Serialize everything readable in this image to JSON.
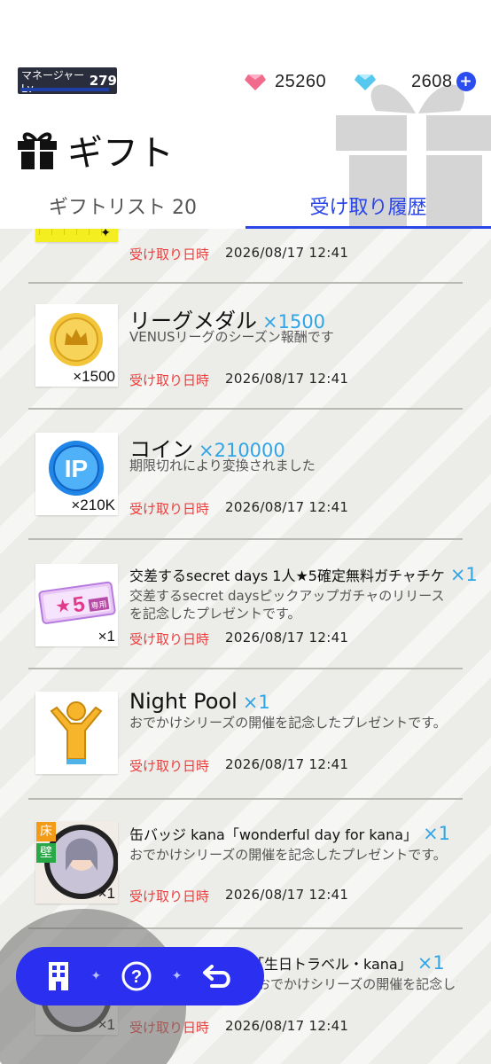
{
  "header": {
    "level_label": "マネージャーLv",
    "level_value": "279",
    "gem_paid": "25260",
    "gem_free": "2608",
    "title": "ギフト",
    "gift_icon": "gift-icon",
    "gem_icon": "diamond-icon"
  },
  "tabs": [
    {
      "label": "ギフトリスト 20",
      "active": false
    },
    {
      "label": "受け取り履歴",
      "active": true
    }
  ],
  "colors": {
    "accent": "#2b46e8",
    "received_label": "#ee3d3d",
    "multiplier": "#2fa5e8",
    "nav_bg": "#2b2fef"
  },
  "items": [
    {
      "title": "",
      "mult": "",
      "desc": "",
      "qty": "",
      "recv_label": "受け取り日時",
      "date": "2026/08/17  12:41"
    },
    {
      "title": "リーグメダル",
      "mult": "×1500",
      "desc": "VENUSリーグのシーズン報酬です",
      "qty": "×1500",
      "recv_label": "受け取り日時",
      "date": "2026/08/17  12:41"
    },
    {
      "title": "コイン",
      "mult": "×210000",
      "desc": "期限切れにより変換されました",
      "qty": "×210K",
      "recv_label": "受け取り日時",
      "date": "2026/08/17  12:41"
    },
    {
      "title": "交差するsecret days 1人★5確定無料ガチャチケ",
      "mult": "×1",
      "desc": "交差するsecret daysピックアップガチャのリリースを記念したプレゼントです。",
      "qty": "×1",
      "recv_label": "受け取り日時",
      "date": "2026/08/17  12:41",
      "ticket_text": "5",
      "ticket_sub": "専用"
    },
    {
      "title": "Night Pool",
      "mult": "×1",
      "desc": "おでかけシリーズの開催を記念したプレゼントです。",
      "qty": "",
      "recv_label": "受け取り日時",
      "date": "2026/08/17  12:41"
    },
    {
      "title": "缶バッジ kana「wonderful day for kana」",
      "mult": "×1",
      "desc": "おでかけシリーズの開催を記念したプレゼントです。",
      "qty": "×1",
      "recv_label": "受け取り日時",
      "date": "2026/08/17  12:41",
      "tag1": "床",
      "tag2": "壁"
    },
    {
      "title": "「生日トラベル・kana」",
      "mult": "×1",
      "desc": "おでかけシリーズの開催を記念したプレゼントで",
      "qty": "×1",
      "recv_label": "受け取り日時",
      "date": "2026/08/17  12:41"
    }
  ],
  "bottom_nav": {
    "icons": [
      "building-icon",
      "help-icon",
      "back-arrow-icon"
    ]
  }
}
